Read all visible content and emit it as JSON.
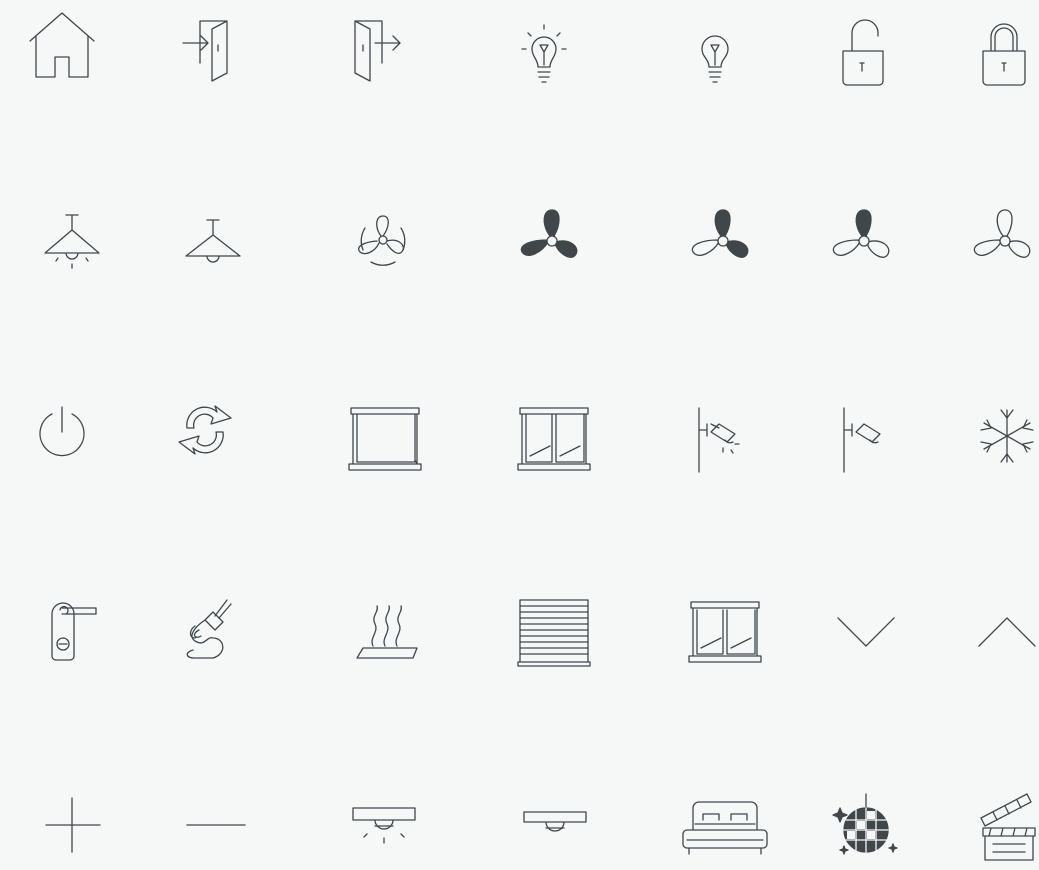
{
  "icon_color": "#3f474b",
  "background": "#f6f7f7",
  "rows": [
    [
      "home-icon",
      "door-enter-icon",
      "door-exit-icon",
      "light-bulb-on-icon",
      "light-bulb-off-icon",
      "padlock-open-icon",
      "padlock-closed-icon"
    ],
    [
      "pendant-lamp-on-icon",
      "pendant-lamp-off-icon",
      "fan-spinning-icon",
      "fan-speed-3-icon",
      "fan-speed-2-icon",
      "fan-speed-1-icon",
      "fan-off-icon"
    ],
    [
      "power-icon",
      "refresh-icon",
      "window-blind-icon",
      "window-icon",
      "wall-spotlight-on-icon",
      "wall-spotlight-off-icon",
      "snowflake-icon"
    ],
    [
      "door-hanger-do-not-disturb-icon",
      "cleaning-icon",
      "heated-floor-icon",
      "roller-shutter-icon",
      "window-open-icon",
      "chevron-down-icon",
      "chevron-up-icon"
    ],
    [
      "plus-icon",
      "minus-icon",
      "ceiling-light-on-icon",
      "ceiling-light-off-icon",
      "bed-icon",
      "disco-ball-icon",
      "clapperboard-icon"
    ]
  ]
}
